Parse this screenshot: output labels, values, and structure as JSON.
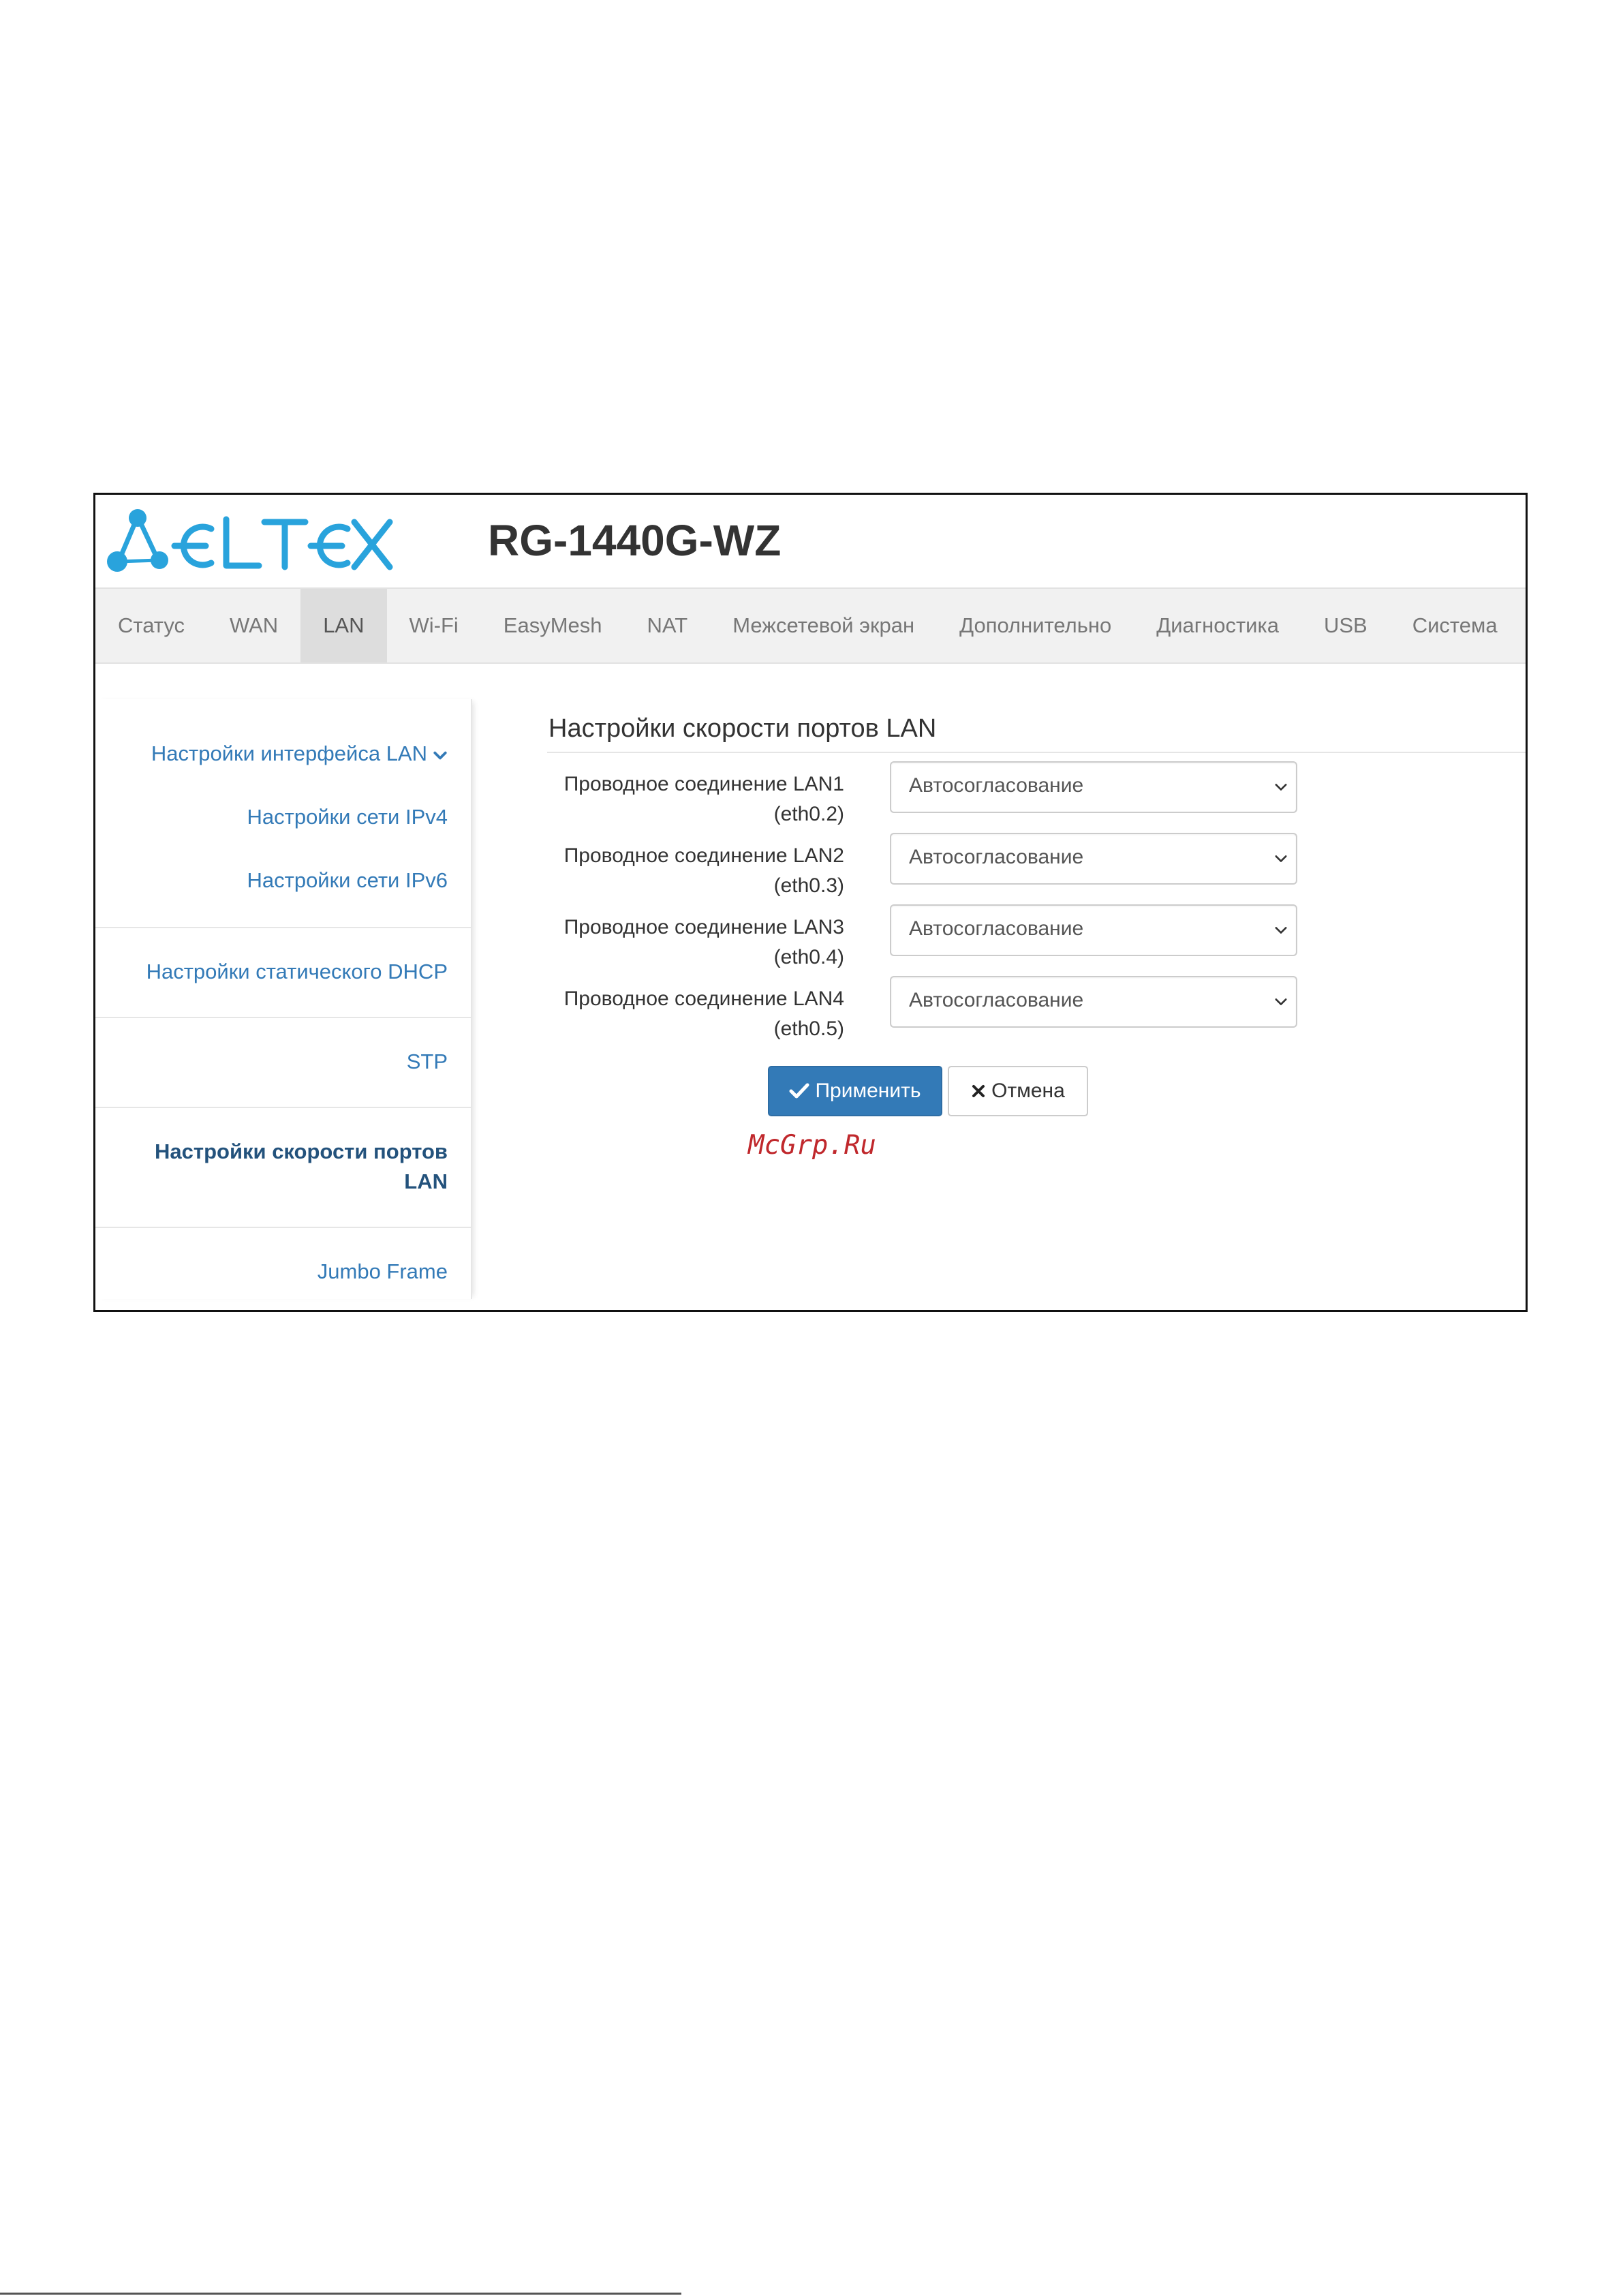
{
  "header": {
    "brand": "ELTEX",
    "model": "RG-1440G-WZ"
  },
  "nav": {
    "items": [
      {
        "label": "Статус",
        "active": false
      },
      {
        "label": "WAN",
        "active": false
      },
      {
        "label": "LAN",
        "active": true
      },
      {
        "label": "Wi-Fi",
        "active": false
      },
      {
        "label": "EasyMesh",
        "active": false
      },
      {
        "label": "NAT",
        "active": false
      },
      {
        "label": "Межсетевой экран",
        "active": false
      },
      {
        "label": "Дополнительно",
        "active": false
      },
      {
        "label": "Диагностика",
        "active": false
      },
      {
        "label": "USB",
        "active": false
      },
      {
        "label": "Система",
        "active": false
      }
    ]
  },
  "sidebar": {
    "lan_interface": "Настройки интерфейса LAN",
    "ipv4": "Настройки сети IPv4",
    "ipv6": "Настройки сети IPv6",
    "static_dhcp": "Настройки статического DHCP",
    "stp": "STP",
    "port_speed_line1": "Настройки скорости портов",
    "port_speed_line2": "LAN",
    "jumbo": "Jumbo Frame"
  },
  "main": {
    "title": "Настройки скорости портов LAN",
    "rows": [
      {
        "label": "Проводное соединение LAN1",
        "iface": "(eth0.2)",
        "value": "Автосогласование"
      },
      {
        "label": "Проводное соединение LAN2",
        "iface": "(eth0.3)",
        "value": "Автосогласование"
      },
      {
        "label": "Проводное соединение LAN3",
        "iface": "(eth0.4)",
        "value": "Автосогласование"
      },
      {
        "label": "Проводное соединение LAN4",
        "iface": "(eth0.5)",
        "value": "Автосогласование"
      }
    ],
    "apply_label": "Применить",
    "cancel_label": "Отмена"
  },
  "watermark": "McGrp.Ru",
  "colors": {
    "brand": "#29a3dc",
    "link": "#337ab7",
    "link_active": "#23527c",
    "primary_button": "#337ab7",
    "nav_bg": "#f1f1f1",
    "nav_active_bg": "#dddddd",
    "watermark": "#c0282c"
  },
  "icons": {
    "logo": "eltex-logo",
    "expand": "chevron-down-icon",
    "select_arrow": "chevron-down-icon",
    "apply": "check-icon",
    "cancel": "close-icon"
  }
}
